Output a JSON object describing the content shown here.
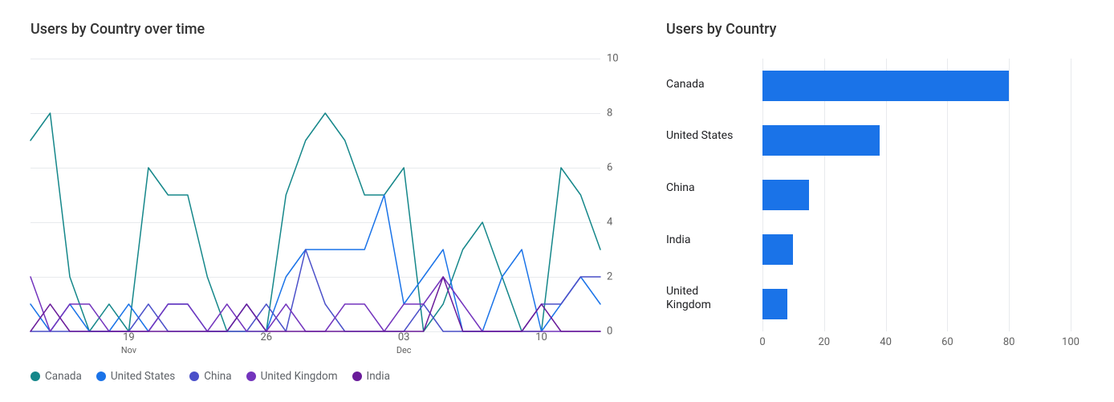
{
  "left_panel": {
    "title": "Users by Country over time",
    "legend": [
      {
        "name": "Canada",
        "color": "#15878a"
      },
      {
        "name": "United States",
        "color": "#1a73e8"
      },
      {
        "name": "China",
        "color": "#4b50c9"
      },
      {
        "name": "United Kingdom",
        "color": "#7334bd"
      },
      {
        "name": "India",
        "color": "#6a1b9a"
      }
    ]
  },
  "right_panel": {
    "title": "Users by Country"
  },
  "chart_data": [
    {
      "type": "line",
      "title": "Users by Country over time",
      "xlabel": "",
      "ylabel": "",
      "ylim": [
        0,
        10
      ],
      "y_ticks": [
        0,
        2,
        4,
        6,
        8,
        10
      ],
      "x_dates": [
        "Nov 14",
        "Nov 15",
        "Nov 16",
        "Nov 17",
        "Nov 18",
        "Nov 19",
        "Nov 20",
        "Nov 21",
        "Nov 22",
        "Nov 23",
        "Nov 24",
        "Nov 25",
        "Nov 26",
        "Nov 27",
        "Nov 28",
        "Nov 29",
        "Nov 30",
        "Dec 01",
        "Dec 02",
        "Dec 03",
        "Dec 04",
        "Dec 05",
        "Dec 06",
        "Dec 07",
        "Dec 08",
        "Dec 09",
        "Dec 10",
        "Dec 11",
        "Dec 12",
        "Dec 13"
      ],
      "x_tick_indices": [
        5,
        12,
        19,
        26
      ],
      "x_tick_labels": [
        {
          "day": "19",
          "month": "Nov"
        },
        {
          "day": "26",
          "month": ""
        },
        {
          "day": "03",
          "month": "Dec"
        },
        {
          "day": "10",
          "month": ""
        }
      ],
      "series": [
        {
          "name": "Canada",
          "color": "#15878a",
          "values": [
            7,
            8,
            2,
            0,
            1,
            0,
            6,
            5,
            5,
            2,
            0,
            0,
            0,
            5,
            7,
            8,
            7,
            5,
            5,
            6,
            0,
            1,
            3,
            4,
            2,
            0,
            0,
            6,
            5,
            3
          ]
        },
        {
          "name": "United States",
          "color": "#1a73e8",
          "values": [
            1,
            0,
            1,
            0,
            0,
            1,
            0,
            1,
            1,
            0,
            0,
            1,
            0,
            2,
            3,
            3,
            3,
            3,
            5,
            1,
            2,
            3,
            0,
            0,
            2,
            3,
            0,
            1,
            2,
            1
          ]
        },
        {
          "name": "China",
          "color": "#4b50c9",
          "values": [
            0,
            0,
            0,
            0,
            0,
            0,
            1,
            0,
            0,
            0,
            0,
            0,
            1,
            0,
            3,
            1,
            0,
            0,
            0,
            0,
            1,
            0,
            0,
            0,
            0,
            0,
            1,
            1,
            2,
            2
          ]
        },
        {
          "name": "United Kingdom",
          "color": "#7334bd",
          "values": [
            2,
            0,
            1,
            1,
            0,
            0,
            0,
            1,
            1,
            0,
            1,
            0,
            0,
            1,
            0,
            0,
            1,
            1,
            0,
            1,
            1,
            2,
            1,
            0,
            0,
            0,
            0,
            0,
            0,
            0
          ]
        },
        {
          "name": "India",
          "color": "#6a1b9a",
          "values": [
            0,
            1,
            0,
            0,
            0,
            0,
            0,
            0,
            0,
            0,
            0,
            1,
            0,
            0,
            0,
            0,
            0,
            0,
            0,
            0,
            0,
            2,
            0,
            0,
            0,
            0,
            1,
            0,
            0,
            0
          ]
        }
      ]
    },
    {
      "type": "bar",
      "orientation": "horizontal",
      "title": "Users by Country",
      "xlabel": "",
      "ylabel": "",
      "xlim": [
        0,
        100
      ],
      "x_ticks": [
        0,
        20,
        40,
        60,
        80,
        100
      ],
      "categories": [
        "Canada",
        "United States",
        "China",
        "India",
        "United Kingdom"
      ],
      "values": [
        80,
        38,
        15,
        10,
        8
      ],
      "bar_color": "#1a73e8"
    }
  ]
}
